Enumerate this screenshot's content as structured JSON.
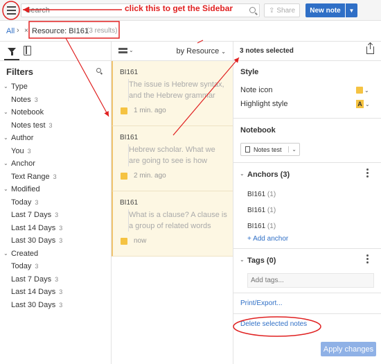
{
  "topbar": {
    "search_placeholder": "Search",
    "share_label": "Share",
    "new_note_label": "New note"
  },
  "breadcrumb": {
    "all": "All",
    "separator": "›",
    "clear": "×",
    "resource": "Resource: BI161",
    "count": "(3 results)"
  },
  "filters": {
    "title": "Filters",
    "groups": [
      {
        "name": "Type",
        "items": [
          {
            "label": "Notes",
            "count": "3"
          }
        ]
      },
      {
        "name": "Notebook",
        "items": [
          {
            "label": "Notes test",
            "count": "3"
          }
        ]
      },
      {
        "name": "Author",
        "items": [
          {
            "label": "You",
            "count": "3"
          }
        ]
      },
      {
        "name": "Anchor",
        "items": [
          {
            "label": "Text Range",
            "count": "3"
          }
        ]
      },
      {
        "name": "Modified",
        "items": [
          {
            "label": "Today",
            "count": "3"
          },
          {
            "label": "Last 7 Days",
            "count": "3"
          },
          {
            "label": "Last 14 Days",
            "count": "3"
          },
          {
            "label": "Last 30 Days",
            "count": "3"
          }
        ]
      },
      {
        "name": "Created",
        "items": [
          {
            "label": "Today",
            "count": "3"
          },
          {
            "label": "Last 7 Days",
            "count": "3"
          },
          {
            "label": "Last 14 Days",
            "count": "3"
          },
          {
            "label": "Last 30 Days",
            "count": "3"
          }
        ]
      }
    ]
  },
  "notes": {
    "sort_label": "by Resource",
    "cards": [
      {
        "resource": "BI161",
        "line1": "The issue is Hebrew syntax,",
        "line2": "and the Hebrew grammar",
        "time": "1 min. ago"
      },
      {
        "resource": "BI161",
        "line1": "Hebrew scholar. What we",
        "line2": "are going to see is how",
        "time": "2 min. ago"
      },
      {
        "resource": "BI161",
        "line1": "What is a clause? A clause is",
        "line2": "a group of related words",
        "time": "now"
      }
    ]
  },
  "details": {
    "selected": "3 notes selected",
    "style_title": "Style",
    "note_icon_label": "Note icon",
    "highlight_label": "Highlight style",
    "highlight_glyph": "A",
    "notebook_title": "Notebook",
    "notebook_value": "Notes test",
    "anchors_title": "Anchors (3)",
    "anchors": [
      {
        "label": "BI161",
        "count": "(1)"
      },
      {
        "label": "BI161",
        "count": "(1)"
      },
      {
        "label": "BI161",
        "count": "(1)"
      }
    ],
    "add_anchor": "+ Add anchor",
    "tags_title": "Tags (0)",
    "tags_placeholder": "Add tags...",
    "print_export": "Print/Export...",
    "delete_selected": "Delete selected notes",
    "apply": "Apply changes"
  },
  "annotation": {
    "text": "click this to get the Sidebar",
    "color": "#e02020"
  },
  "colors": {
    "accent": "#2f6fc6",
    "note_bg": "#fdf7e3",
    "note_icon": "#f5c342"
  }
}
